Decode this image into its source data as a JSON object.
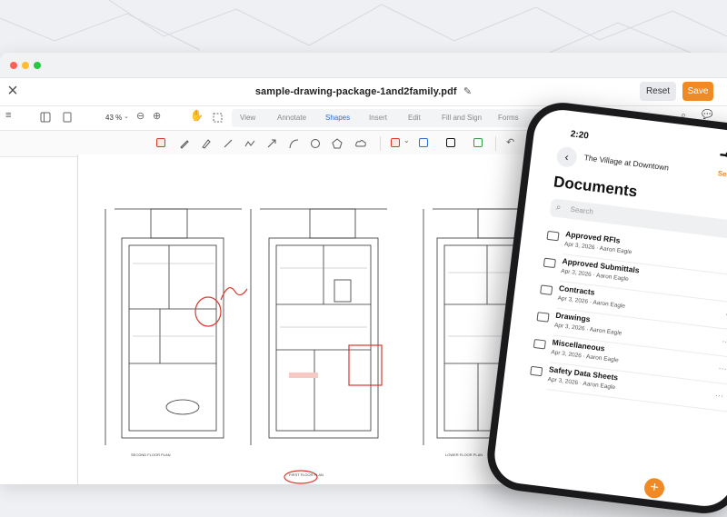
{
  "window": {
    "file_name": "sample-drawing-package-1and2family.pdf",
    "reset_label": "Reset",
    "save_label": "Save"
  },
  "toolbar": {
    "zoom": "43 %",
    "tabs": [
      "View",
      "Annotate",
      "Shapes",
      "Insert",
      "Edit",
      "Fill and Sign",
      "Forms"
    ],
    "active_tab": "Shapes"
  },
  "colors": {
    "accent": "#f08a24",
    "active_tab": "#2d6cdf",
    "markup_red": "#d9382b"
  },
  "drawing": {
    "labels": [
      "SECOND FLOOR PLAN",
      "FIRST FLOOR PLAN",
      "LOWER FLOOR PLAN"
    ]
  },
  "phone": {
    "time": "2:20",
    "project": "The Village at Downtown",
    "select_label": "Select",
    "title": "Documents",
    "search_placeholder": "Search",
    "documents": [
      {
        "name": "Approved RFIs",
        "date": "Apr 3, 2026",
        "user": "Aaron Eagle"
      },
      {
        "name": "Approved Submittals",
        "date": "Apr 3, 2026",
        "user": "Aaron Eagle"
      },
      {
        "name": "Contracts",
        "date": "Apr 3, 2026",
        "user": "Aaron Eagle"
      },
      {
        "name": "Drawings",
        "date": "Apr 3, 2026",
        "user": "Aaron Eagle"
      },
      {
        "name": "Miscellaneous",
        "date": "Apr 3, 2026",
        "user": "Aaron Eagle"
      },
      {
        "name": "Safety Data Sheets",
        "date": "Apr 3, 2026",
        "user": "Aaron Eagle"
      }
    ]
  }
}
